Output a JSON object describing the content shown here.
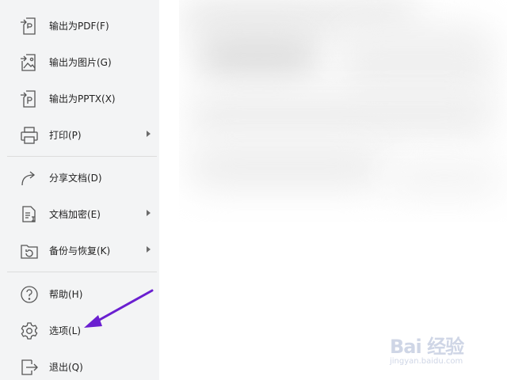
{
  "menu": {
    "items": [
      {
        "label": "输出为PDF(F)",
        "icon": "export-pdf-icon",
        "has_submenu": false
      },
      {
        "label": "输出为图片(G)",
        "icon": "export-image-icon",
        "has_submenu": false
      },
      {
        "label": "输出为PPTX(X)",
        "icon": "export-pptx-icon",
        "has_submenu": false
      },
      {
        "label": "打印(P)",
        "icon": "printer-icon",
        "has_submenu": true
      },
      {
        "label": "分享文档(D)",
        "icon": "share-icon",
        "has_submenu": false
      },
      {
        "label": "文档加密(E)",
        "icon": "document-encrypt-icon",
        "has_submenu": true
      },
      {
        "label": "备份与恢复(K)",
        "icon": "backup-restore-icon",
        "has_submenu": true
      },
      {
        "label": "帮助(H)",
        "icon": "help-icon",
        "has_submenu": false
      },
      {
        "label": "选项(L)",
        "icon": "gear-icon",
        "has_submenu": false
      },
      {
        "label": "退出(Q)",
        "icon": "exit-icon",
        "has_submenu": false
      }
    ]
  },
  "annotation": {
    "color": "#6a1fd0",
    "points_to": "选项(L)"
  },
  "watermark": {
    "brand": "Bai 经验",
    "url": "jingyan.baidu.com"
  },
  "colors": {
    "menu_bg": "#f3f4f5",
    "text": "#222222",
    "icon": "#555555"
  }
}
